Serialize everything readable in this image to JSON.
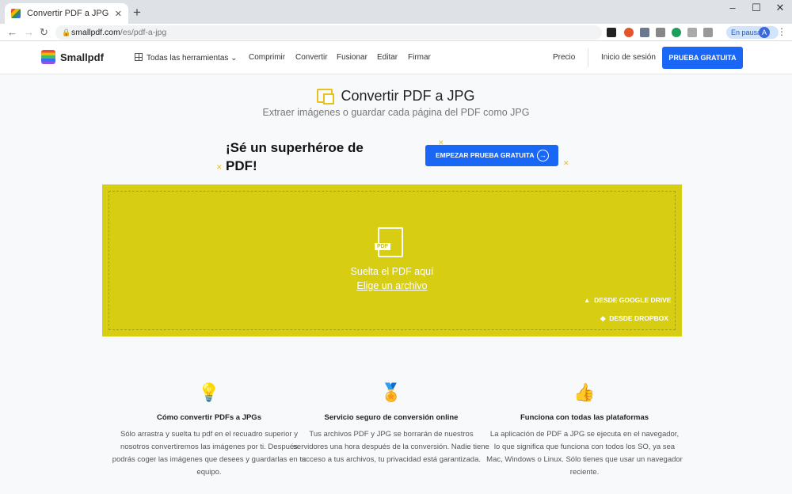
{
  "browser": {
    "tab_title": "Convertir PDF a JPG – Convierte",
    "url_domain": "smallpdf.com",
    "url_path": "/es/pdf-a-jpg",
    "profile_status": "En pausa",
    "avatar_letter": "A"
  },
  "site": {
    "logo": "Smallpdf",
    "nav": {
      "all_tools": "Todas las herramientas",
      "compress": "Comprimir",
      "convert": "Convertir",
      "merge": "Fusionar",
      "edit": "Editar",
      "sign": "Firmar",
      "pricing": "Precio",
      "login": "Inicio de sesión",
      "trial_button": "PRUEBA GRATUITA"
    }
  },
  "hero": {
    "title": "Convertir PDF a JPG",
    "subtitle": "Extraer imágenes o guardar cada página del PDF como JPG",
    "promo_line1": "¡Sé un superhéroe de",
    "promo_line2": "PDF!",
    "promo_button": "EMPEZAR PRUEBA GRATUITA"
  },
  "dropzone": {
    "pdf_tag": "PDF",
    "drop_text": "Suelta el PDF aquí",
    "choose_link": "Elige un archivo",
    "google_drive": "DESDE GOOGLE DRIVE",
    "dropbox": "DESDE DROPBOX",
    "color": "#d7cd12"
  },
  "features": [
    {
      "icon": "lightbulb-icon",
      "title": "Cómo convertir PDFs a JPGs",
      "text": "Sólo arrastra y suelta tu pdf en el recuadro superior y nosotros convertiremos las imágenes por ti. Después podrás coger las imágenes que desees y guardarlas en tu equipo."
    },
    {
      "icon": "award-icon",
      "title": "Servicio seguro de conversión online",
      "text": "Tus archivos PDF y JPG se borrarán de nuestros servidores una hora después de la conversión. Nadie tiene acceso a tus archivos, tu privacidad está garantizada."
    },
    {
      "icon": "thumbs-up-icon",
      "title": "Funciona con todas las plataformas",
      "text": "La aplicación de PDF a JPG se ejecuta en el navegador, lo que significa que funciona con todos los SO, ya sea Mac, Windows o Linux. Sólo tienes que usar un navegador reciente."
    }
  ]
}
